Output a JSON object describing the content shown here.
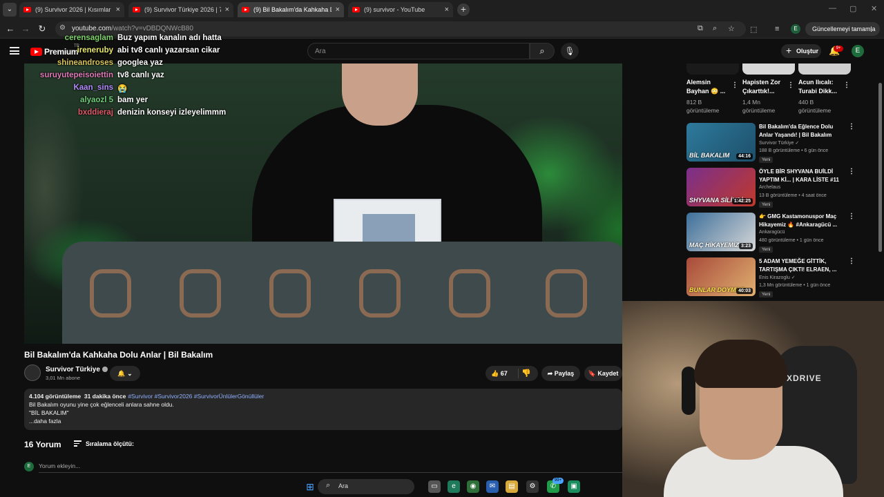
{
  "browser": {
    "tabs": [
      {
        "title": "(9) Survivor 2026 | Kısımlar - Yo",
        "active": false
      },
      {
        "title": "(9) Survivor Türkiye 2026 | 7. H",
        "active": false
      },
      {
        "title": "(9) Bil Bakalım'da Kahkaha Dolu",
        "active": true
      },
      {
        "title": "(9) survivor - YouTube",
        "active": false
      }
    ],
    "url_host": "youtube.com",
    "url_path": "/watch?v=vDBDQNWcB80",
    "profile_letter": "E",
    "update_label": "Güncellemeyi tamamla"
  },
  "youtube": {
    "logo_text": "Premium",
    "region": "TR",
    "search_placeholder": "Ara",
    "create_label": "Oluştur",
    "notifications": "9+",
    "avatar_letter": "E"
  },
  "chat": [
    {
      "name": "cerensaglam",
      "color": "#7fd36b",
      "message": "Buz yapım kanalın adı hatta"
    },
    {
      "name": "ireneruby",
      "color": "#e8e86a",
      "message": "abi tv8 canlı yazarsan cikar"
    },
    {
      "name": "shineandroses",
      "color": "#d6c45a",
      "message": "googlea yaz"
    },
    {
      "name": "suruyutepeisoiettin",
      "color": "#e07ab8",
      "message": "tv8 canlı yaz"
    },
    {
      "name": "Kaan_sins",
      "color": "#b48cff",
      "message": "😭"
    },
    {
      "name": "alyaozl 5",
      "color": "#6fcf7a",
      "message": "bam yer"
    },
    {
      "name": "bxddieraj",
      "color": "#e05a6a",
      "message": "denizin konseyi izleyelimmm"
    }
  ],
  "video": {
    "title": "Bil Bakalım'da Kahkaha Dolu Anlar | Bil Bakalım",
    "channel": "Survivor Türkiye",
    "subscribers": "3,01 Mn abone",
    "likes": "67",
    "share_label": "Paylaş",
    "save_label": "Kaydet",
    "views": "4.104 görüntüleme",
    "age": "31 dakika önce",
    "hashtags": "#Survivor #Survivor2026 #SurvivorÜnlülerGönüllüler",
    "description_line1": "Bil Bakalım oyunu yine çok eğlenceli anlara sahne oldu.",
    "description_line2": "\"BİL BAKALIM\"",
    "more_label": "...daha fazla"
  },
  "comments": {
    "count_label": "16 Yorum",
    "sort_label": "Sıralama ölçütü:",
    "add_placeholder": "Yorum ekleyin...",
    "user_letter": "E"
  },
  "shorts": [
    {
      "title": "Alemsin Bayhan 😳 ...",
      "views": "812 B görüntüleme"
    },
    {
      "title": "Hapisten Zor Çıkarttık!...",
      "views": "1,4 Mn görüntüleme"
    },
    {
      "title": "Acun Ilıcalı: Turabi Dikk...",
      "views": "440 B görüntüleme"
    }
  ],
  "recommendations": [
    {
      "title": "Bil Bakalım'da Eğlence Dolu Anlar Yaşandı! | Bil Bakalım",
      "channel": "Survivor Türkiye",
      "verified": true,
      "meta": "188 B görüntüleme • 6 gün önce",
      "badge": "Yeni",
      "duration": "44:16",
      "thumb_text": "BİL BAKALIM",
      "thumb_color": "#2e7a9c"
    },
    {
      "title": "ÖYLE BİR SHYVANA BUİLDİ YAPTIM Kİ... | KARA LİSTE #11",
      "channel": "Archelaus",
      "verified": false,
      "meta": "13 B görüntüleme • 4 saat önce",
      "badge": "Yeni",
      "duration": "1:42:25",
      "thumb_text": "SHYVANA SİLİNDİ",
      "thumb_color": "#7a2f8c"
    },
    {
      "title": "👉 GMG Kastamonuspor Maç Hikayemiz 🔥 #Ankaragücü ...",
      "channel": "Ankaragücü",
      "verified": false,
      "meta": "480 görüntüleme • 1 gün önce",
      "badge": "Yeni",
      "duration": "3:23",
      "thumb_text": "MAÇ HİKAYEMİZ",
      "thumb_color": "#3d6f9a"
    },
    {
      "title": "5 ADAM YEMEĞE GİTTİK, TARTIŞMA ÇIKTI! ELRAEN, ...",
      "channel": "Enis Kirazoglu",
      "verified": true,
      "meta": "1,3 Mn görüntüleme • 1 gün önce",
      "badge": "Yeni",
      "duration": "40:03",
      "thumb_text": "BUNLAR DOYMAZ",
      "thumb_color": "#a84a3a"
    }
  ],
  "webcam": {
    "chair_brand": "XDRIVE"
  },
  "taskbar": {
    "search_label": "Ara",
    "whatsapp_badge": "99+"
  }
}
